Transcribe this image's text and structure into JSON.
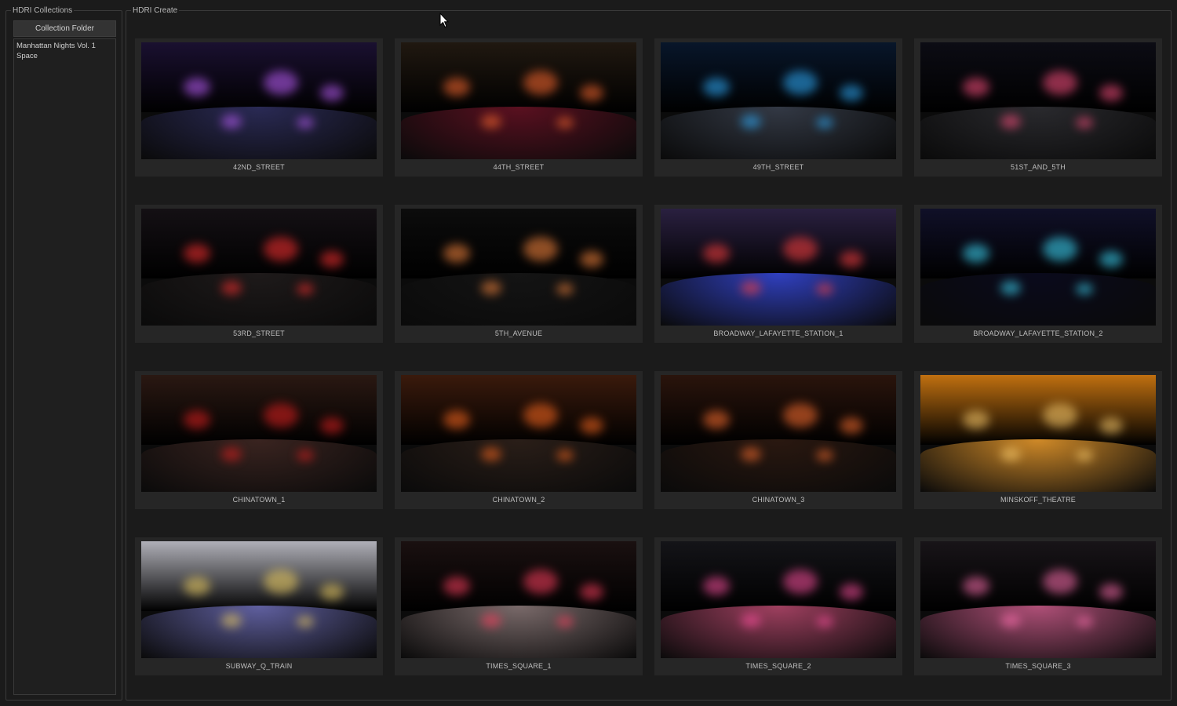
{
  "left_panel": {
    "title": "HDRI Collections",
    "folder_button": "Collection Folder",
    "collections": [
      "Manhattan Nights Vol. 1",
      "Space"
    ]
  },
  "right_panel": {
    "title": "HDRI Create",
    "items": [
      {
        "label": "42ND_STREET",
        "sky": "#1a1030",
        "ground": "#2a2a55",
        "accent": "#c060ff"
      },
      {
        "label": "44TH_STREET",
        "sky": "#201810",
        "ground": "#5a1020",
        "accent": "#ff6a30"
      },
      {
        "label": "49TH_STREET",
        "sky": "#08162a",
        "ground": "#333945",
        "accent": "#30b0ff"
      },
      {
        "label": "51ST_AND_5TH",
        "sky": "#0c0c14",
        "ground": "#2a2a2e",
        "accent": "#ff5080"
      },
      {
        "label": "53RD_STREET",
        "sky": "#141014",
        "ground": "#1e1a1a",
        "accent": "#ff3030"
      },
      {
        "label": "5TH_AVENUE",
        "sky": "#0c0c0c",
        "ground": "#141414",
        "accent": "#ff8a40"
      },
      {
        "label": "BROADWAY_LAFAYETTE_STATION_1",
        "sky": "#2a2040",
        "ground": "#3040c0",
        "accent": "#ff4040"
      },
      {
        "label": "BROADWAY_LAFAYETTE_STATION_2",
        "sky": "#101028",
        "ground": "#0a0a1c",
        "accent": "#40e0ff"
      },
      {
        "label": "CHINATOWN_1",
        "sky": "#2a1812",
        "ground": "#3a2420",
        "accent": "#e02020"
      },
      {
        "label": "CHINATOWN_2",
        "sky": "#3a1a0c",
        "ground": "#2a1e18",
        "accent": "#ff6a20"
      },
      {
        "label": "CHINATOWN_3",
        "sky": "#2a140c",
        "ground": "#2a1810",
        "accent": "#ff7030"
      },
      {
        "label": "MINSKOFF_THEATRE",
        "sky": "#c07010",
        "ground": "#d08a28",
        "accent": "#ffd070"
      },
      {
        "label": "SUBWAY_Q_TRAIN",
        "sky": "#b0b0b8",
        "ground": "#6060a0",
        "accent": "#f0d060"
      },
      {
        "label": "TIMES_SQUARE_1",
        "sky": "#1a1010",
        "ground": "#7a6a6a",
        "accent": "#ff4060"
      },
      {
        "label": "TIMES_SQUARE_2",
        "sky": "#141418",
        "ground": "#a04060",
        "accent": "#ff50a0"
      },
      {
        "label": "TIMES_SQUARE_3",
        "sky": "#181418",
        "ground": "#b05078",
        "accent": "#ff70b0"
      }
    ]
  }
}
